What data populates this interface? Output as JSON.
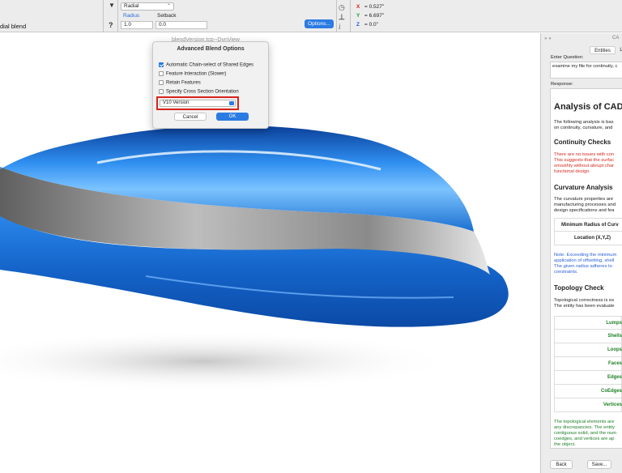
{
  "toolbar": {
    "blend_label": "dial blend",
    "type_select": "Radial",
    "radius_label": "Radius",
    "setback_label": "Setback",
    "radius_value": "1.0",
    "setback_value": "0.0",
    "options_button": "Options...",
    "help_mark": "?",
    "arrow_mark": "▼",
    "coords": {
      "x": "0.527\"",
      "y": "6.697\"",
      "z": "0.0\""
    }
  },
  "viewport": {
    "title": "blendVersion.tcp--DynView"
  },
  "dialog": {
    "title": "Advanced Blend Options",
    "options": [
      {
        "label": "Automatic Chain-select of Shared Edges",
        "checked": true
      },
      {
        "label": "Feature Interaction (Slower)",
        "checked": false
      },
      {
        "label": "Retain Features",
        "checked": false
      },
      {
        "label": "Specify Cross Section Orientation",
        "checked": false
      }
    ],
    "version_select": "V10 Version",
    "cancel_button": "Cancel",
    "ok_button": "OK"
  },
  "panel": {
    "header_partial": "CA",
    "tabs": [
      "Entities",
      "L"
    ],
    "question_label": "Enter Question:",
    "question_value": "examine my file for continuity, c",
    "response_label": "Response:",
    "response": {
      "title": "Analysis of CAD D",
      "intro": [
        "The following analysis is bas",
        "on continuity, curvature, and"
      ],
      "continuity_heading": "Continuity Checks",
      "continuity_text": [
        "There are no issues with con",
        "This suggests that the surfac",
        "smoothly without abrupt char",
        "functional design."
      ],
      "curvature_heading": "Curvature Analysis",
      "curvature_text": [
        "The curvature properties are",
        "manufacturing processes and",
        "design specifications and fea"
      ],
      "curvature_table": [
        "Minimum Radius of Curv",
        "Location (X,Y,Z)"
      ],
      "note_text": [
        "Note: Exceeding the minimum",
        "application of offsetting, shell",
        "The given radius adheres to",
        "constraints."
      ],
      "topology_heading": "Topology Check",
      "topology_text": [
        "Topological correctness is es",
        "The entity has been evaluate"
      ],
      "topology_table": [
        "Lumps",
        "Shells",
        "Loops",
        "Faces",
        "Edges",
        "CoEdges",
        "Vertices"
      ],
      "conclusion_text": [
        "The topological elements are",
        "any discrepancies. The entity",
        "contiguous solid, and the num",
        "coedges, and vertices are ap",
        "the object."
      ]
    },
    "back_button": "Back",
    "save_button": "Save..."
  },
  "colors": {
    "accent": "#2b7be3",
    "highlight": "#d8231b",
    "body_blue": "#1a6fd0",
    "band_gray": "#8f8f8f"
  }
}
